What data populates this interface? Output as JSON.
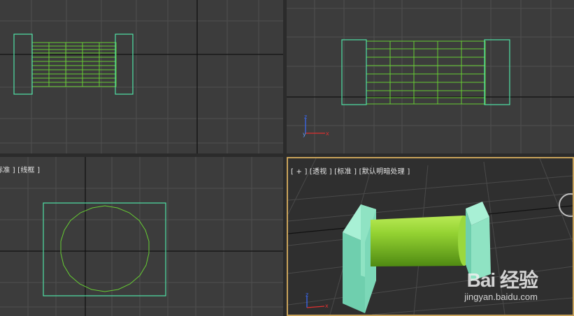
{
  "viewports": {
    "top": {
      "name": "top-viewport"
    },
    "front": {
      "name": "front-viewport"
    },
    "left": {
      "label": "标准 ] [线框 ]"
    },
    "perspective": {
      "label": "[ + ]  [透视 ]  [标准 ]  [默认明暗处理 ]"
    }
  },
  "axes": {
    "x": "x",
    "y": "y",
    "z": "z"
  },
  "watermark": {
    "logo": "Bai  经验",
    "url": "jingyan.baidu.com"
  },
  "colors": {
    "wireframe_box": "#4fe3a6",
    "wireframe_cylinder": "#66cc33",
    "grid": "#4f4f4f",
    "axis_line": "#111111",
    "cylinder_fill": "#8ccf2f",
    "box_fill": "#8fe3c3",
    "active_border": "#c8a25a"
  }
}
